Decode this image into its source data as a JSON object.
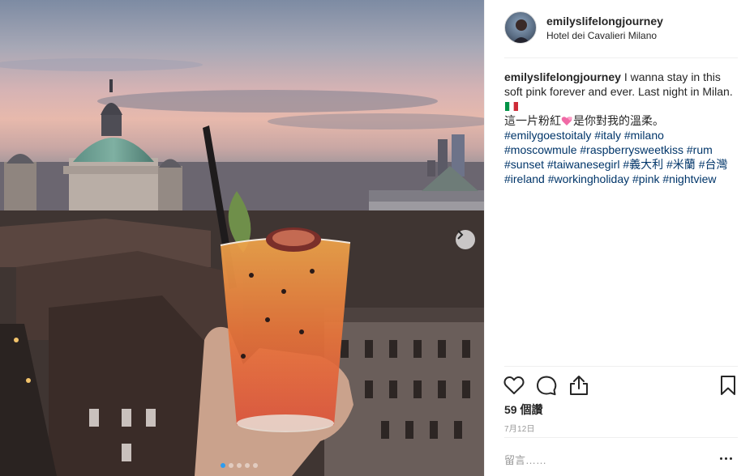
{
  "post": {
    "username": "emilyslifelongjourney",
    "location": "Hotel dei Cavalieri Milano",
    "caption": {
      "username": "emilyslifelongjourney",
      "text_line1": "I wanna stay in this soft pink forever and ever. Last night in Milan.",
      "flag_emoji": "🇮🇹",
      "text_line2_prefix": "這一片粉紅",
      "heart_emoji": "💕",
      "text_line2_suffix": "是你對我的溫柔。",
      "hashtags": [
        "#emilygoestoitaly",
        "#italy",
        "#milano",
        "#moscowmule",
        "#raspberrysweetkiss",
        "#rum",
        "#sunset",
        "#taiwanesegirl",
        "#義大利",
        "#米蘭",
        "#台灣",
        "#ireland",
        "#workingholiday",
        "#pink",
        "#nightview"
      ]
    },
    "likes": "59 個讚",
    "date": "7月12日",
    "comment_placeholder": "留言……"
  },
  "carousel": {
    "count": 5,
    "active_index": 0
  },
  "icons": {
    "like": "heart-outline-icon",
    "comment": "comment-bubble-icon",
    "share": "share-upload-icon",
    "save": "bookmark-icon",
    "next": "chevron-right-icon",
    "more": "ellipsis-icon"
  },
  "colors": {
    "text": "#262626",
    "hashtag": "#003569",
    "muted": "#999999",
    "border": "#efefef",
    "carousel_active": "#2d9cf0"
  }
}
